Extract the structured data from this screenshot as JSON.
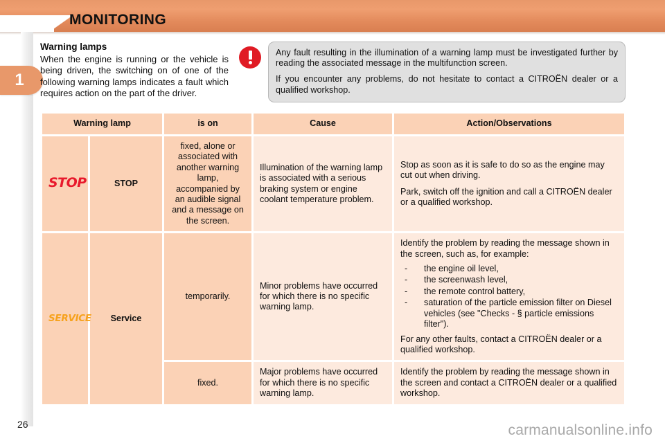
{
  "header": {
    "title": "MONITORING",
    "chapter_number": "1",
    "band_color": "#e8986a"
  },
  "intro": {
    "heading": "Warning lamps",
    "body": "When the engine is running or the vehicle is being driven, the switching on of one of the following warning lamps indicates a fault which requires action on the part of the driver."
  },
  "callout": {
    "icon": "exclamation-circle-icon",
    "icon_color": "#e01b24",
    "paragraphs": [
      "Any fault resulting in the illumination of a warning lamp must be investigated further by reading the associated message in the multifunction screen.",
      "If you encounter any problems, do not hesitate to contact a CITROËN dealer or a qualified workshop."
    ]
  },
  "table": {
    "headers": {
      "warning_lamp": "Warning lamp",
      "is_on": "is on",
      "cause": "Cause",
      "action": "Action/Observations"
    },
    "rows": [
      {
        "lamp_glyph": "STOP",
        "lamp_glyph_color": "#e8192c",
        "lamp_name": "STOP",
        "is_on": "fixed, alone or associated with another warning lamp, accompanied by an audible signal and a message on the screen.",
        "cause": "Illumination of the warning lamp is associated with a serious braking system or engine coolant temperature problem.",
        "action_paragraphs": [
          "Stop as soon as it is safe to do so as the engine may cut out when driving.",
          "Park, switch off the ignition and call a CITROËN dealer or a qualified workshop."
        ]
      },
      {
        "lamp_glyph": "SERVICE",
        "lamp_glyph_color": "#f6a21d",
        "lamp_name": "Service",
        "is_on": "temporarily.",
        "cause": "Minor problems have occurred for which there is no specific warning lamp.",
        "action_intro": "Identify the problem by reading the message shown in the screen, such as, for example:",
        "action_bullets": [
          "the engine oil level,",
          "the screenwash level,",
          "the remote control battery,",
          "saturation of the particle emission filter on Diesel vehicles (see \"Checks - § particle emissions filter\")."
        ],
        "action_outro": "For any other faults, contact a CITROËN dealer or a qualified workshop.",
        "bullet_dash": "-"
      },
      {
        "is_on": "fixed.",
        "cause": "Major problems have occurred for which there is no specific warning lamp.",
        "action_paragraphs": [
          "Identify the problem by reading the message shown in the screen and contact a CITROËN dealer or a qualified workshop."
        ]
      }
    ]
  },
  "footer": {
    "page_number": "26",
    "watermark": "carmanualsonline.info"
  }
}
